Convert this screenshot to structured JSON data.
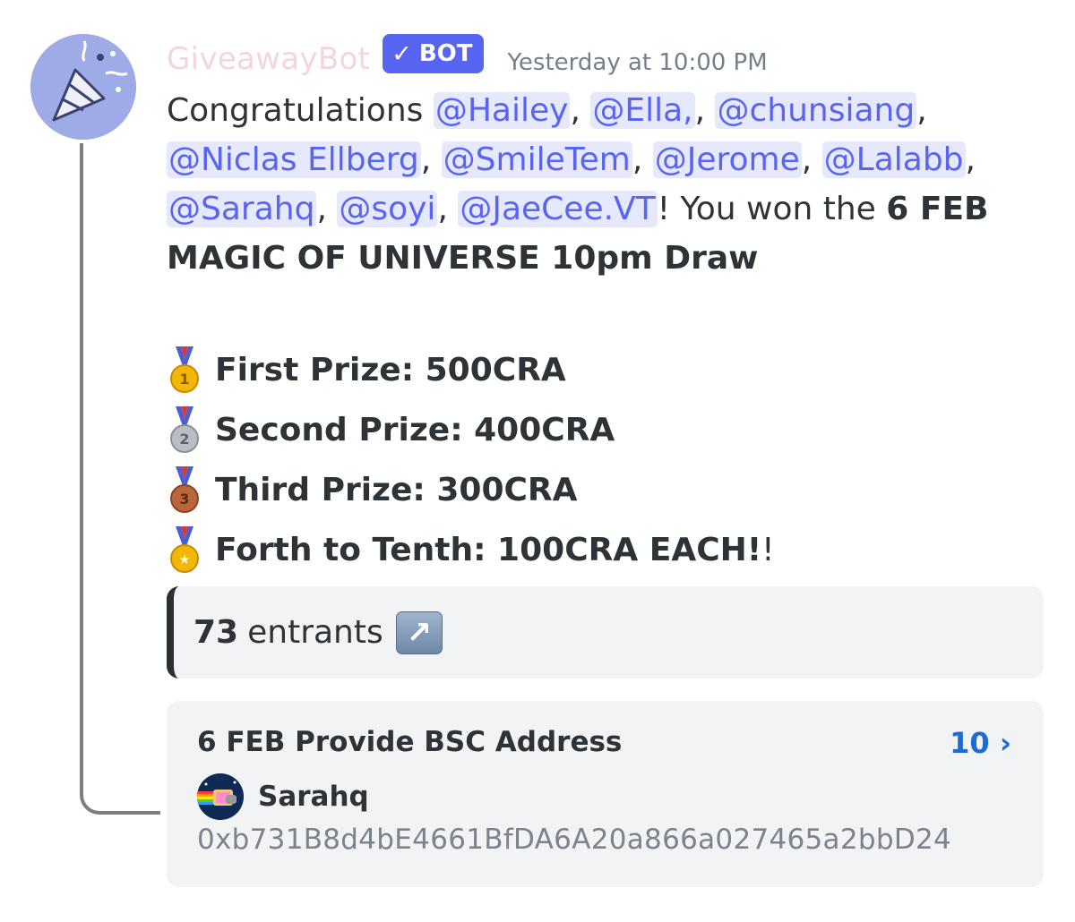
{
  "message": {
    "author": "GiveawayBot",
    "bot_tag": "BOT",
    "timestamp": "Yesterday at 10:00 PM",
    "intro": "Congratulations ",
    "mentions": [
      "@Hailey",
      "@Ella,",
      "@chunsiang",
      "@Niclas Ellberg",
      "@SmileTem",
      "@Jerome",
      "@Lalabb",
      "@Sarahq",
      "@soyi",
      "@JaeCee.VT"
    ],
    "sep": ", ",
    "won_text": "! You won the ",
    "draw_name_1": "6 FEB",
    "draw_name_2": "MAGIC OF UNIVERSE 10pm Draw",
    "prizes": [
      {
        "medal": "first-place-medal",
        "text": "First Prize: 500CRA",
        "tail": ""
      },
      {
        "medal": "second-place-medal",
        "text": "Second Prize: 400CRA",
        "tail": ""
      },
      {
        "medal": "third-place-medal",
        "text": "Third Prize: 300CRA",
        "tail": ""
      },
      {
        "medal": "sports-medal",
        "text": "Forth to Tenth: 100CRA EACH!",
        "tail": "!"
      }
    ]
  },
  "embed": {
    "count": "73",
    "label": "entrants",
    "icon": "up-right-arrow-icon"
  },
  "thread": {
    "title": "6 FEB Provide BSC Address",
    "count": "10 ›",
    "username": "Sarahq",
    "message": "0xb731B8d4bE4661BfDA6A20a866a027465a2bbD24"
  },
  "colors": {
    "blurple": "#5865f2",
    "mention_bg": "#e6e8fd",
    "link_blue": "#1e6ad6",
    "embed_bg": "#f2f3f5"
  }
}
